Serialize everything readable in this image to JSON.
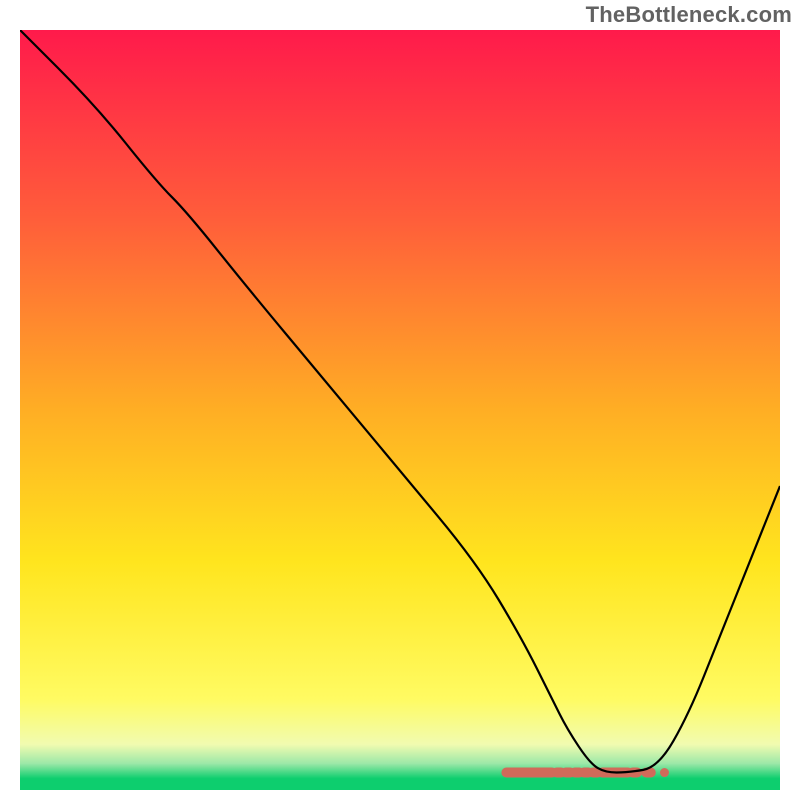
{
  "watermark": "TheBottleneck.com",
  "chart_data": {
    "type": "line",
    "title": "",
    "xlabel": "",
    "ylabel": "",
    "xlim": [
      0,
      100
    ],
    "ylim": [
      0,
      100
    ],
    "grid": false,
    "background_gradient": {
      "stops": [
        {
          "offset": 0.0,
          "color": "#ff1a4b"
        },
        {
          "offset": 0.25,
          "color": "#ff5e3a"
        },
        {
          "offset": 0.5,
          "color": "#ffae24"
        },
        {
          "offset": 0.7,
          "color": "#ffe51e"
        },
        {
          "offset": 0.88,
          "color": "#fffb62"
        },
        {
          "offset": 0.94,
          "color": "#f1fbb0"
        },
        {
          "offset": 0.965,
          "color": "#9de8a8"
        },
        {
          "offset": 0.985,
          "color": "#0dce6e"
        },
        {
          "offset": 1.0,
          "color": "#0dce6e"
        }
      ]
    },
    "series": [
      {
        "name": "bottleneck-curve",
        "color": "#000000",
        "x": [
          0,
          10,
          18,
          22,
          30,
          40,
          50,
          60,
          66,
          70,
          72,
          75,
          77,
          80,
          84,
          88,
          92,
          96,
          100
        ],
        "y": [
          100,
          90,
          80,
          76,
          66,
          54,
          42,
          30,
          20,
          12,
          8,
          3.5,
          2.3,
          2.3,
          3,
          10,
          20,
          30,
          40
        ]
      }
    ],
    "markers": {
      "name": "optimal-range-strip",
      "color": "#d16a5a",
      "y": 2.3,
      "x_start": 64,
      "x_segments": [
        [
          64.0,
          70.0
        ],
        [
          70.6,
          71.2
        ],
        [
          71.8,
          72.4
        ],
        [
          73.0,
          73.6
        ],
        [
          74.2,
          74.8
        ],
        [
          75.4,
          76.0
        ],
        [
          76.6,
          80.0
        ],
        [
          80.6,
          81.2
        ],
        [
          82.4,
          83.0
        ]
      ]
    }
  }
}
